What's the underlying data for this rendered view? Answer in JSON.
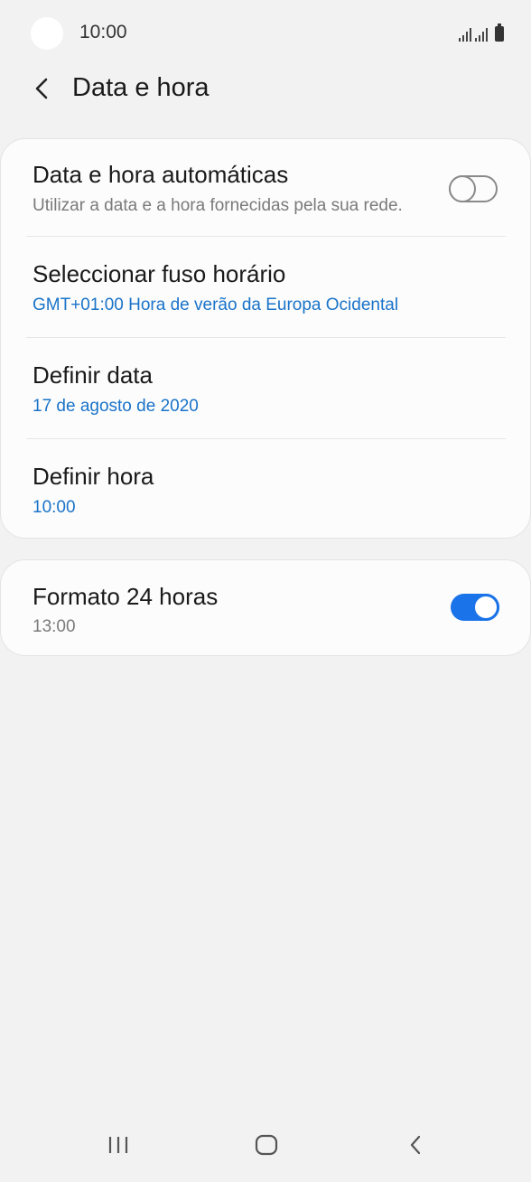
{
  "status_bar": {
    "time": "10:00"
  },
  "header": {
    "title": "Data e hora"
  },
  "settings": {
    "auto_datetime": {
      "title": "Data e hora automáticas",
      "subtitle": "Utilizar a data e a hora fornecidas pela sua rede.",
      "enabled": false
    },
    "timezone": {
      "title": "Seleccionar fuso horário",
      "value": "GMT+01:00 Hora de verão da Europa Ocidental"
    },
    "set_date": {
      "title": "Definir data",
      "value": "17 de agosto de 2020"
    },
    "set_time": {
      "title": "Definir hora",
      "value": "10:00"
    },
    "format_24h": {
      "title": "Formato 24 horas",
      "subtitle": "13:00",
      "enabled": true
    }
  },
  "colors": {
    "accent": "#1a73e8",
    "link_text": "#1a73c9",
    "background": "#f2f2f2",
    "card": "#fcfcfc"
  },
  "icons": {
    "back": "chevron-left-icon",
    "nav_recents": "recents-icon",
    "nav_home": "home-icon",
    "nav_back": "back-icon"
  }
}
